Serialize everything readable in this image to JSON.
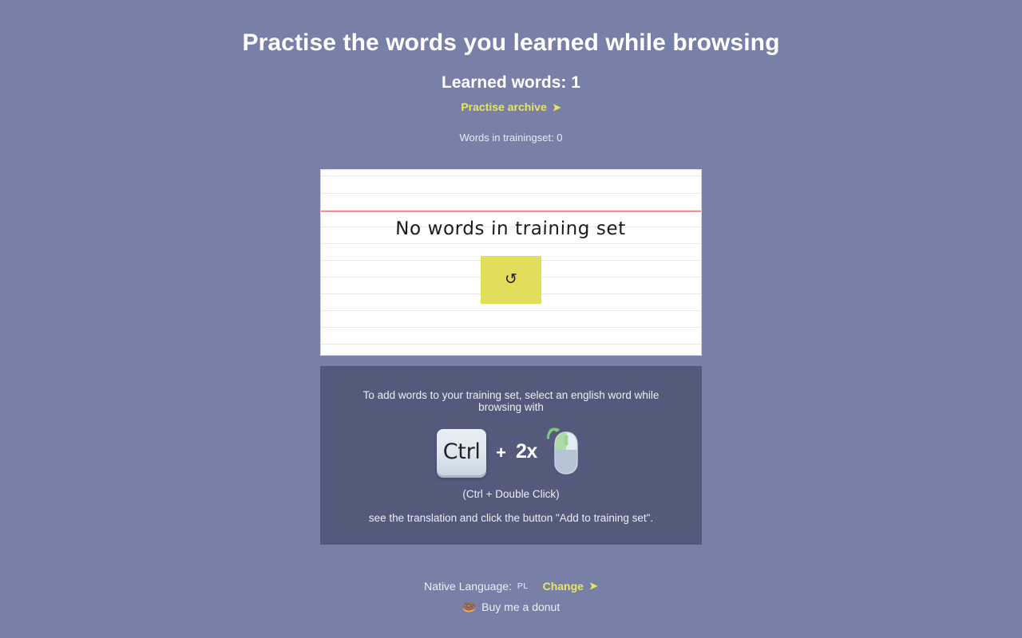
{
  "header": {
    "title": "Practise the words you learned while browsing",
    "learned_words_label": "Learned words: 1",
    "archive_link_label": "Practise archive",
    "archive_link_arrow": "➤",
    "trainingset_count_label": "Words in trainingset: 0"
  },
  "notebook": {
    "empty_message": "No words in training set",
    "refresh_glyph": "↺",
    "refresh_name": "refresh"
  },
  "info_panel": {
    "line1": "To add words to your training set, select an english word while browsing with",
    "key_label": "Ctrl",
    "plus_label": "+",
    "multiplier_label": "2x",
    "mouse_icon_name": "mouse-double-click-icon",
    "line2": "(Ctrl + Double Click)",
    "line3": "see the translation and click the button \"Add to training set\"."
  },
  "footer": {
    "native_language_label": "Native Language:",
    "native_language_value": "PL",
    "change_link_label": "Change",
    "change_link_arrow": "➤",
    "donut_glyph": "🍩",
    "donut_label": "Buy me a donut"
  },
  "colors": {
    "background": "#7880a8",
    "panel": "#535a7c",
    "accent_yellow": "#e8e45e",
    "button_yellow": "#e2de5b",
    "margin_red": "#f08f8f",
    "notebook_white": "#ffffff",
    "mouse_green": "#a8dba0",
    "mouse_body": "#b6c4d6"
  }
}
